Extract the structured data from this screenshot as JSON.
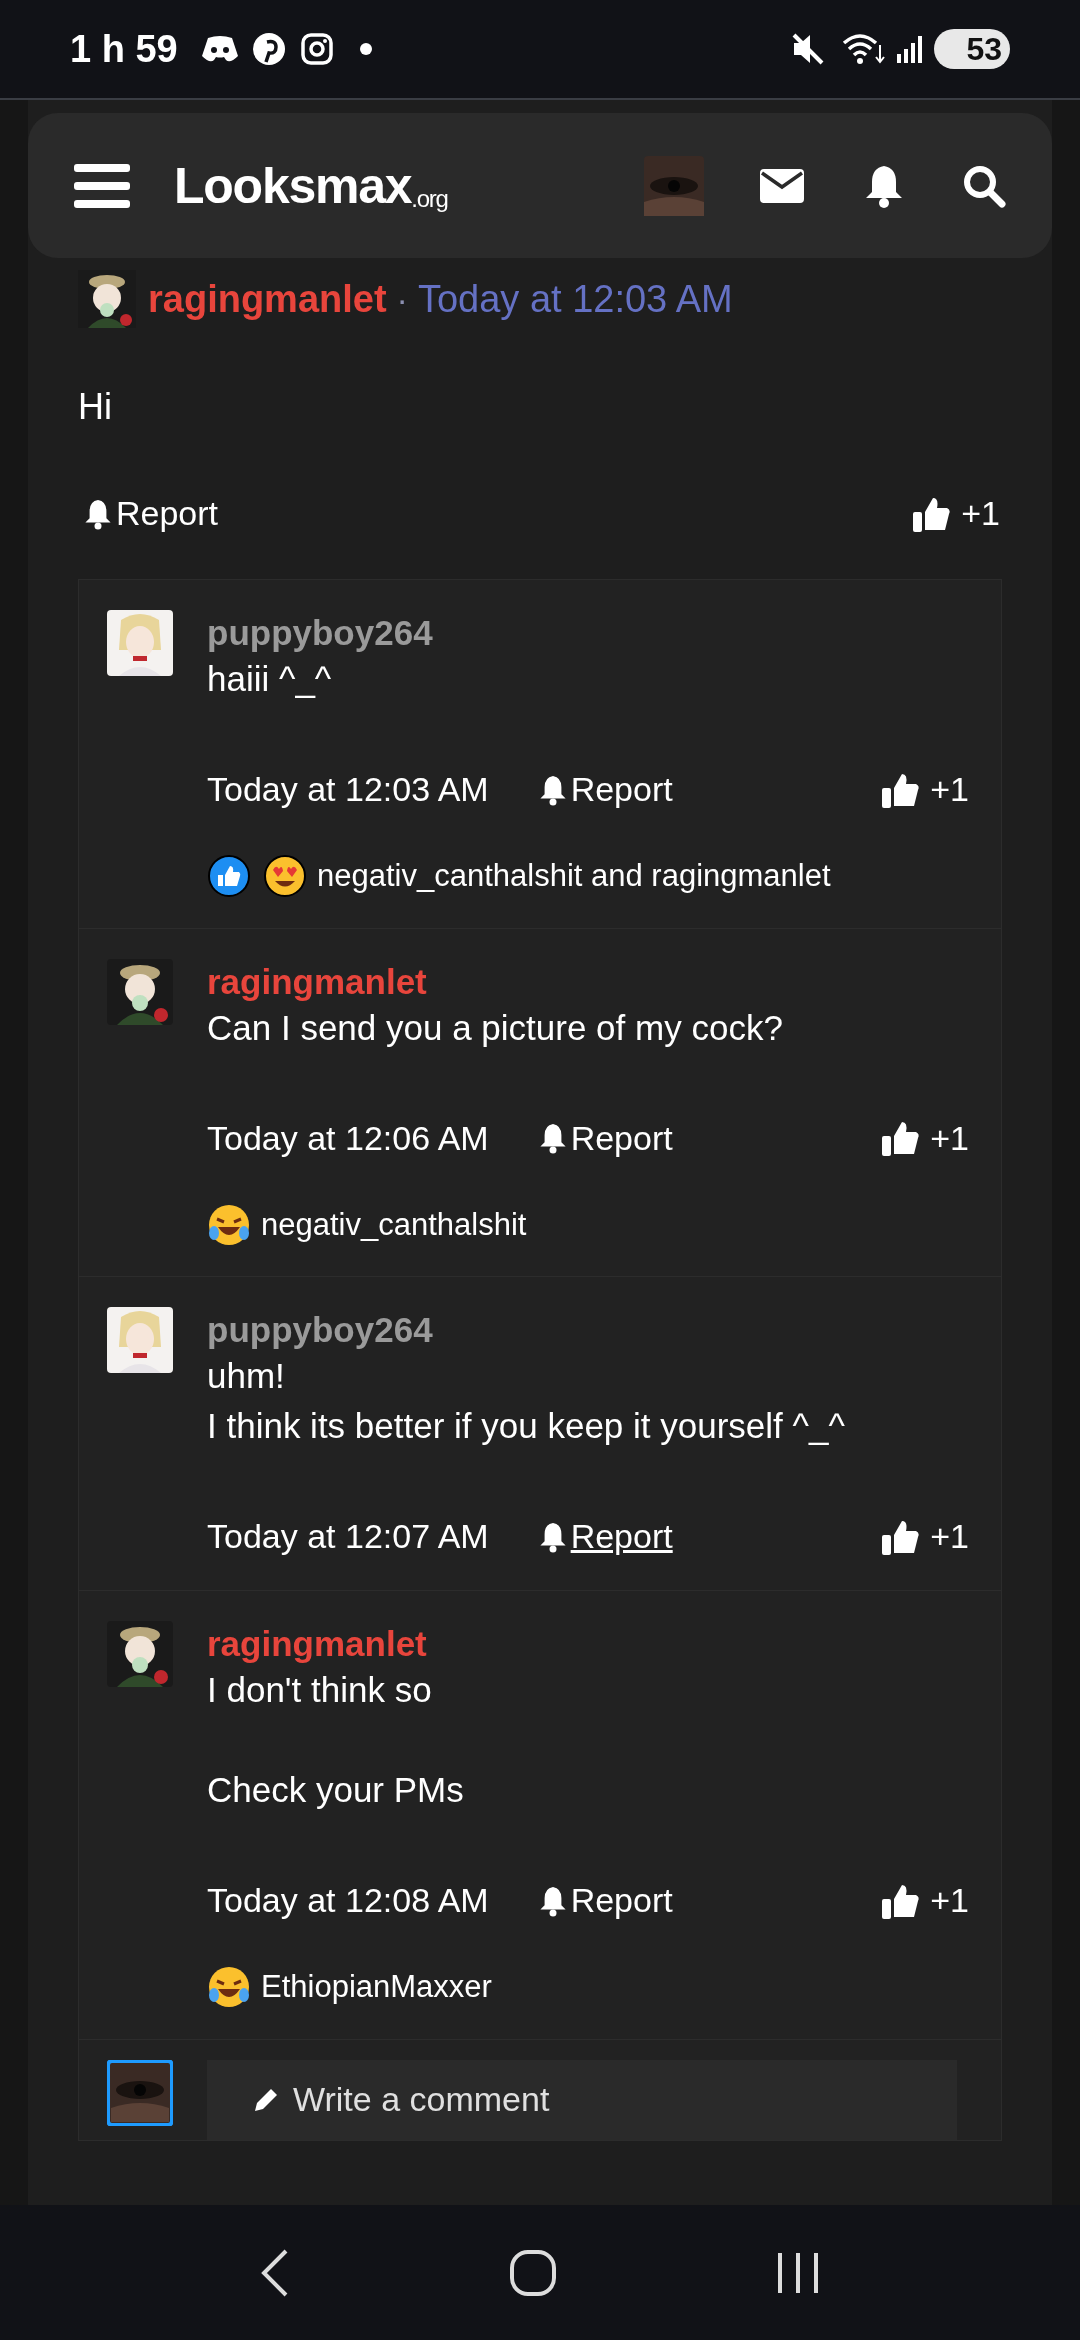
{
  "status_bar": {
    "time": "1 h 59",
    "battery": "53"
  },
  "header": {
    "logo": "Lo",
    "logo_rest": "oksmax",
    "logo_suffix": ".org"
  },
  "post": {
    "author": "ragingmanlet",
    "color": "#e8453c",
    "separator": "·",
    "time": "Today at 12:03 AM",
    "body": [
      "Hi"
    ],
    "report": "Report",
    "likes": "+1"
  },
  "comments": [
    {
      "author": "puppyboy264",
      "color": "#9a9a9a",
      "paragraphs": [
        [
          "haiii ^_^"
        ]
      ],
      "time": "Today at 12:03 AM",
      "report": "Report",
      "report_underlined": false,
      "likes": "+1",
      "reactions": [
        {
          "kind": "like"
        },
        {
          "kind": "love"
        }
      ],
      "reacted_by": "negativ_canthalshit and ragingmanlet"
    },
    {
      "author": "ragingmanlet",
      "color": "#e8453c",
      "paragraphs": [
        [
          "Can I send you a picture of my cock?"
        ]
      ],
      "time": "Today at 12:06 AM",
      "report": "Report",
      "report_underlined": false,
      "likes": "+1",
      "reactions": [
        {
          "kind": "haha"
        }
      ],
      "reacted_by": "negativ_canthalshit"
    },
    {
      "author": "puppyboy264",
      "color": "#9a9a9a",
      "paragraphs": [
        [
          "uhm!",
          "I think its better if you keep it yourself ^_^"
        ]
      ],
      "time": "Today at 12:07 AM",
      "report": "Report",
      "report_underlined": true,
      "likes": "+1"
    },
    {
      "author": "ragingmanlet",
      "color": "#e8453c",
      "paragraphs": [
        [
          "I don't think so"
        ],
        [
          "Check your PMs"
        ]
      ],
      "time": "Today at 12:08 AM",
      "report": "Report",
      "report_underlined": false,
      "likes": "+1",
      "reactions": [
        {
          "kind": "haha"
        }
      ],
      "reacted_by": "EthiopianMaxxer"
    }
  ],
  "composer": {
    "placeholder": "Write a comment"
  }
}
